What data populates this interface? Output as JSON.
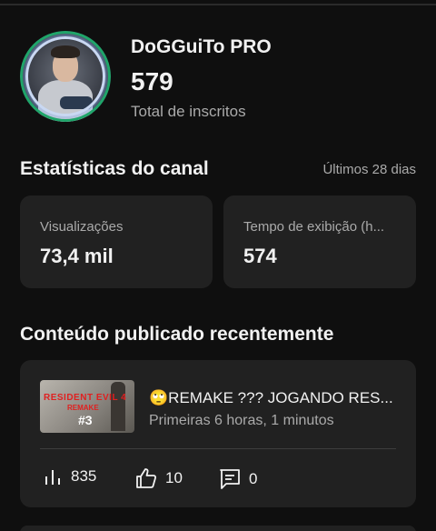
{
  "channel": {
    "name": "DoGGuiTo PRO",
    "subscribers": "579",
    "subscribers_label": "Total de inscritos"
  },
  "stats": {
    "title": "Estatísticas do canal",
    "period": "Últimos 28 dias",
    "views": {
      "label": "Visualizações",
      "value": "73,4 mil"
    },
    "watch_time": {
      "label": "Tempo de exibição (h...",
      "value": "574"
    }
  },
  "recent": {
    "title": "Conteúdo publicado recentemente",
    "video": {
      "title": "🙄REMAKE ??? JOGANDO RES...",
      "meta": "Primeiras 6 horas, 1 minutos",
      "thumbnail_text": {
        "line1": "RESIDENT EVIL 4",
        "line2": "REMAKE",
        "line3": "#3"
      },
      "views": "835",
      "likes": "10",
      "comments": "0"
    }
  },
  "colors": {
    "background": "#0f0f0f",
    "card": "#212121",
    "secondary_text": "#aaaaaa"
  },
  "icons": [
    "views-icon",
    "like-icon",
    "comment-icon"
  ]
}
